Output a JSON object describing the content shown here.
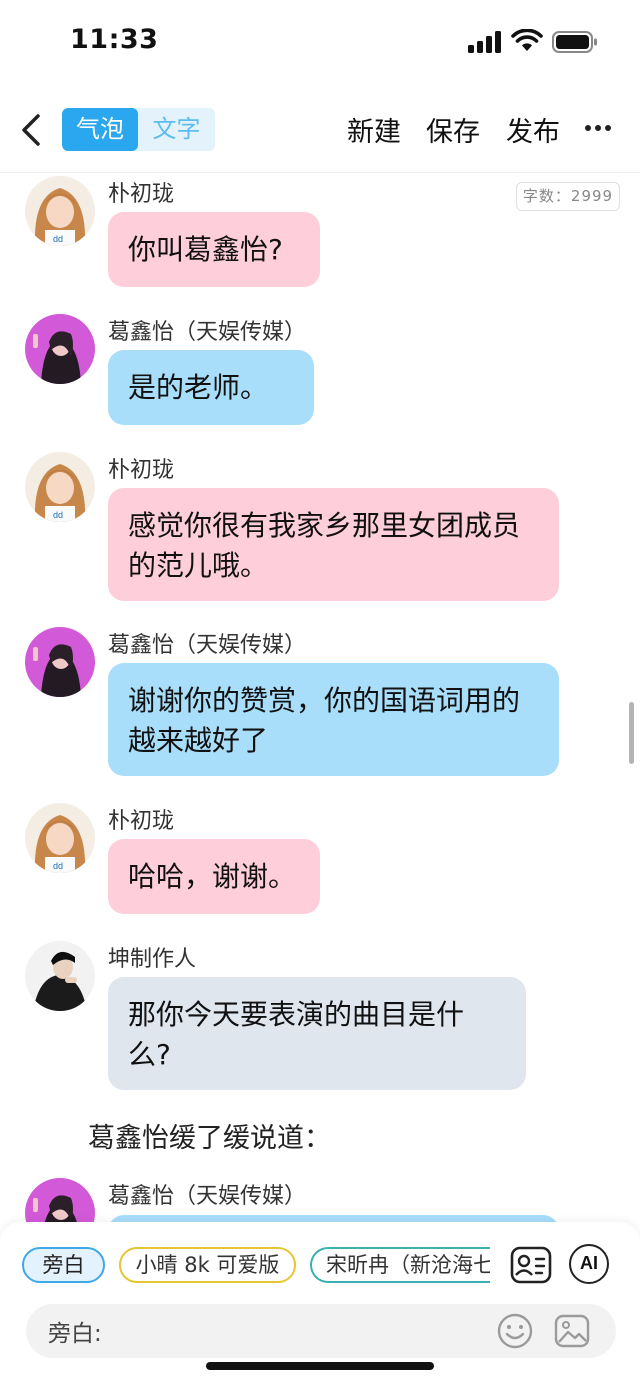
{
  "status": {
    "time": "11:33"
  },
  "nav": {
    "tab_bubble": "气泡",
    "tab_text": "文字",
    "new_label": "新建",
    "save_label": "保存",
    "publish_label": "发布"
  },
  "word_count": "字数：2999",
  "messages": [
    {
      "name": "朴初珑",
      "text": "你叫葛鑫怡?"
    },
    {
      "name": "葛鑫怡（天娱传媒）",
      "text": "是的老师。"
    },
    {
      "name": "朴初珑",
      "text": "感觉你很有我家乡那里女团成员的范儿哦。"
    },
    {
      "name": "葛鑫怡（天娱传媒）",
      "text": "谢谢你的赞赏，你的国语词用的越来越好了"
    },
    {
      "name": "朴初珑",
      "text": "哈哈，谢谢。"
    },
    {
      "name": "坤制作人",
      "text": "那你今天要表演的曲目是什么?"
    },
    {
      "name": "葛鑫怡（天娱传媒）",
      "text": ""
    }
  ],
  "narration": "葛鑫怡缓了缓说道：",
  "roles": [
    "旁白",
    "小晴 8k 可爱版",
    "宋昕冉（新沧海七"
  ],
  "ai_label": "AI",
  "input": {
    "label": "旁白:"
  },
  "colors": {
    "accent": "#2aa7ee",
    "pink_bubble": "#ffcedb",
    "blue_bubble": "#a9defb",
    "gray_bubble": "#e0e6ee"
  }
}
